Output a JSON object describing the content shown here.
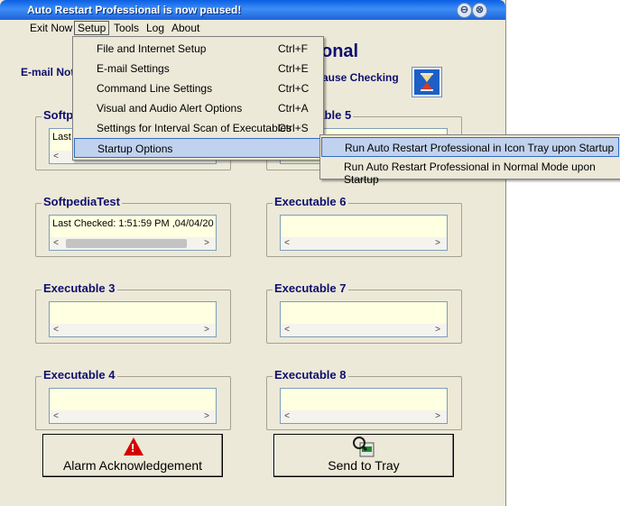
{
  "window": {
    "title": "Auto Restart Professional is now paused!"
  },
  "titlebar": {
    "minimize_glyph": "⊖",
    "close_glyph": "⊗"
  },
  "menu": {
    "items": [
      {
        "label": "Exit Now"
      },
      {
        "label": "Setup"
      },
      {
        "label": "Tools"
      },
      {
        "label": "Log"
      },
      {
        "label": "About"
      }
    ]
  },
  "setup_menu": [
    {
      "label": "File and Internet Setup",
      "shortcut": "Ctrl+F"
    },
    {
      "label": "E-mail Settings",
      "shortcut": "Ctrl+E"
    },
    {
      "label": "Command Line Settings",
      "shortcut": "Ctrl+C"
    },
    {
      "label": "Visual and Audio Alert Options",
      "shortcut": "Ctrl+A"
    },
    {
      "label": "Settings for Interval Scan of Executables",
      "shortcut": "Ctrl+S"
    },
    {
      "label": "Startup Options",
      "shortcut": ""
    }
  ],
  "startup_submenu": [
    {
      "label": "Run Auto Restart Professional in Icon Tray upon Startup"
    },
    {
      "label": "Run Auto Restart Professional in Normal Mode upon Startup"
    }
  ],
  "header": {
    "app_title_fragment": "onal",
    "email_label_fragment": "E-mail Not",
    "pause_label_fragment": "ause Checking"
  },
  "groups": [
    {
      "label": "Softp",
      "text": "Last",
      "scroll_left": "<"
    },
    {
      "label": "table 5",
      "text": ""
    },
    {
      "label": "SoftpediaTest",
      "text": "Last Checked: 1:51:59 PM ,04/04/20"
    },
    {
      "label": "Executable 6",
      "text": ""
    },
    {
      "label": "Executable 3",
      "text": ""
    },
    {
      "label": "Executable 7",
      "text": ""
    },
    {
      "label": "Executable 4",
      "text": ""
    },
    {
      "label": "Executable 8",
      "text": ""
    }
  ],
  "scroll": {
    "left": "<",
    "right": ">"
  },
  "buttons": {
    "alarm": "Alarm Acknowledgement",
    "tray": "Send to Tray"
  },
  "icons": {
    "hourglass": "hourglass-icon",
    "alarm": "warning-icon",
    "tray": "exe-magnifier-icon"
  },
  "colors": {
    "titlebar": "#0a5fe3",
    "listbox_bg": "#ffffe1",
    "label_blue": "#0e0e6e",
    "alarm_red": "#d40000"
  }
}
